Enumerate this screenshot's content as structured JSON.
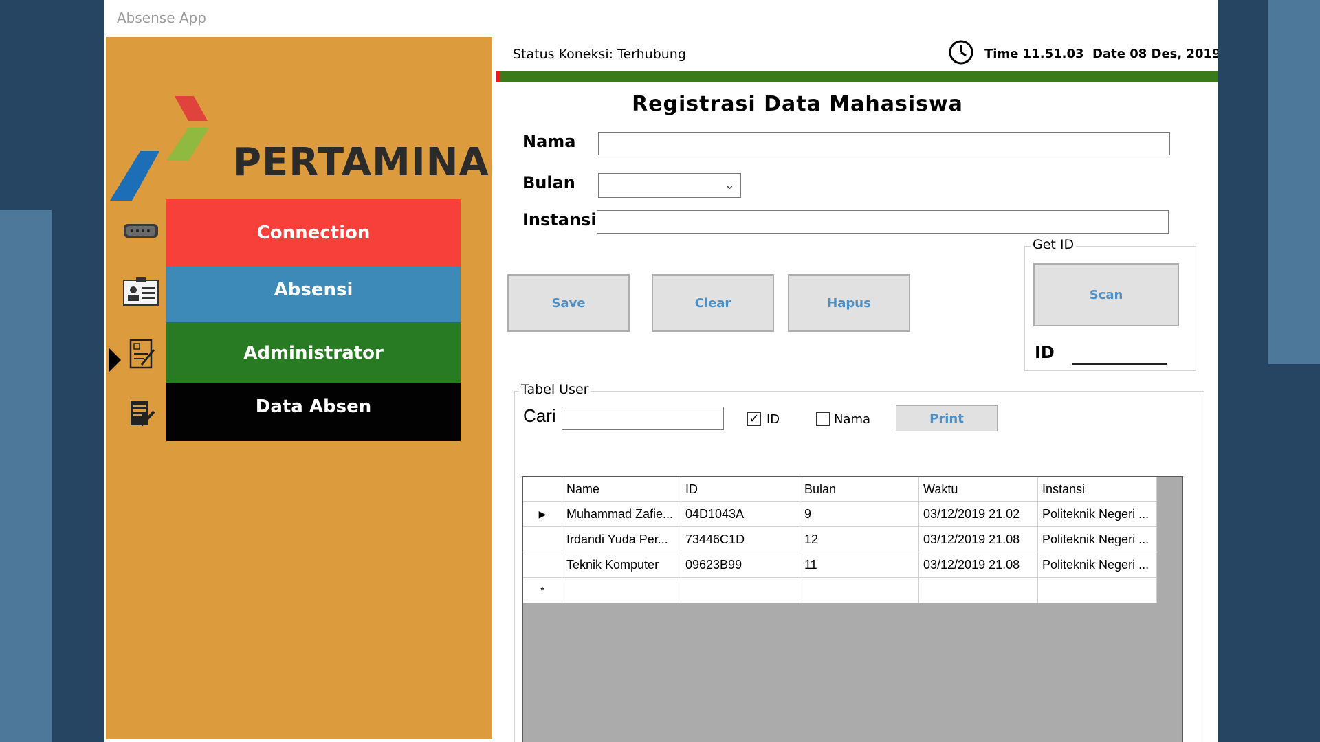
{
  "window": {
    "title": "Absense App"
  },
  "sidebar": {
    "logo_text": "PERTAMINA",
    "items": [
      {
        "label": "Connection",
        "color": "#f7403a",
        "icon": "serial-port-icon"
      },
      {
        "label": "Absensi",
        "color": "#3d89b7",
        "icon": "id-card-icon"
      },
      {
        "label": "Administrator",
        "color": "#287b23",
        "icon": "clipboard-edit-icon"
      },
      {
        "label": "Data Absen",
        "color": "#020202",
        "icon": "document-edit-icon"
      }
    ],
    "background": "#dc9c3d"
  },
  "header": {
    "status": "Status Koneksi: Terhubung",
    "datetime": "Time 11.51.03  Date 08 Des, 2019"
  },
  "form": {
    "title": "Registrasi Data Mahasiswa",
    "nama_label": "Nama",
    "nama_value": "",
    "bulan_label": "Bulan",
    "bulan_value": "",
    "instansi_label": "Instansi",
    "instansi_value": "",
    "save_label": "Save",
    "clear_label": "Clear",
    "hapus_label": "Hapus"
  },
  "get_id": {
    "title": "Get ID",
    "scan_label": "Scan",
    "id_label": "ID",
    "id_value": ""
  },
  "table_group": {
    "title": "Tabel User",
    "cari_label": "Cari",
    "cari_value": "",
    "chk_id_label": "ID",
    "chk_id_checked": true,
    "chk_nama_label": "Nama",
    "chk_nama_checked": false,
    "print_label": "Print"
  },
  "grid": {
    "columns": [
      "Name",
      "ID",
      "Bulan",
      "Waktu",
      "Instansi"
    ],
    "rows": [
      {
        "marker": "▶",
        "cells": [
          "Muhammad Zafie...",
          "04D1043A",
          "9",
          "03/12/2019 21.02",
          "Politeknik Negeri ..."
        ]
      },
      {
        "marker": "",
        "cells": [
          "Irdandi Yuda Per...",
          "73446C1D",
          "12",
          "03/12/2019 21.08",
          "Politeknik Negeri ..."
        ]
      },
      {
        "marker": "",
        "cells": [
          "Teknik Komputer",
          "09623B99",
          "11",
          "03/12/2019 21.08",
          "Politeknik Negeri ..."
        ]
      },
      {
        "marker": "*",
        "cells": [
          "",
          "",
          "",
          "",
          ""
        ]
      }
    ]
  }
}
